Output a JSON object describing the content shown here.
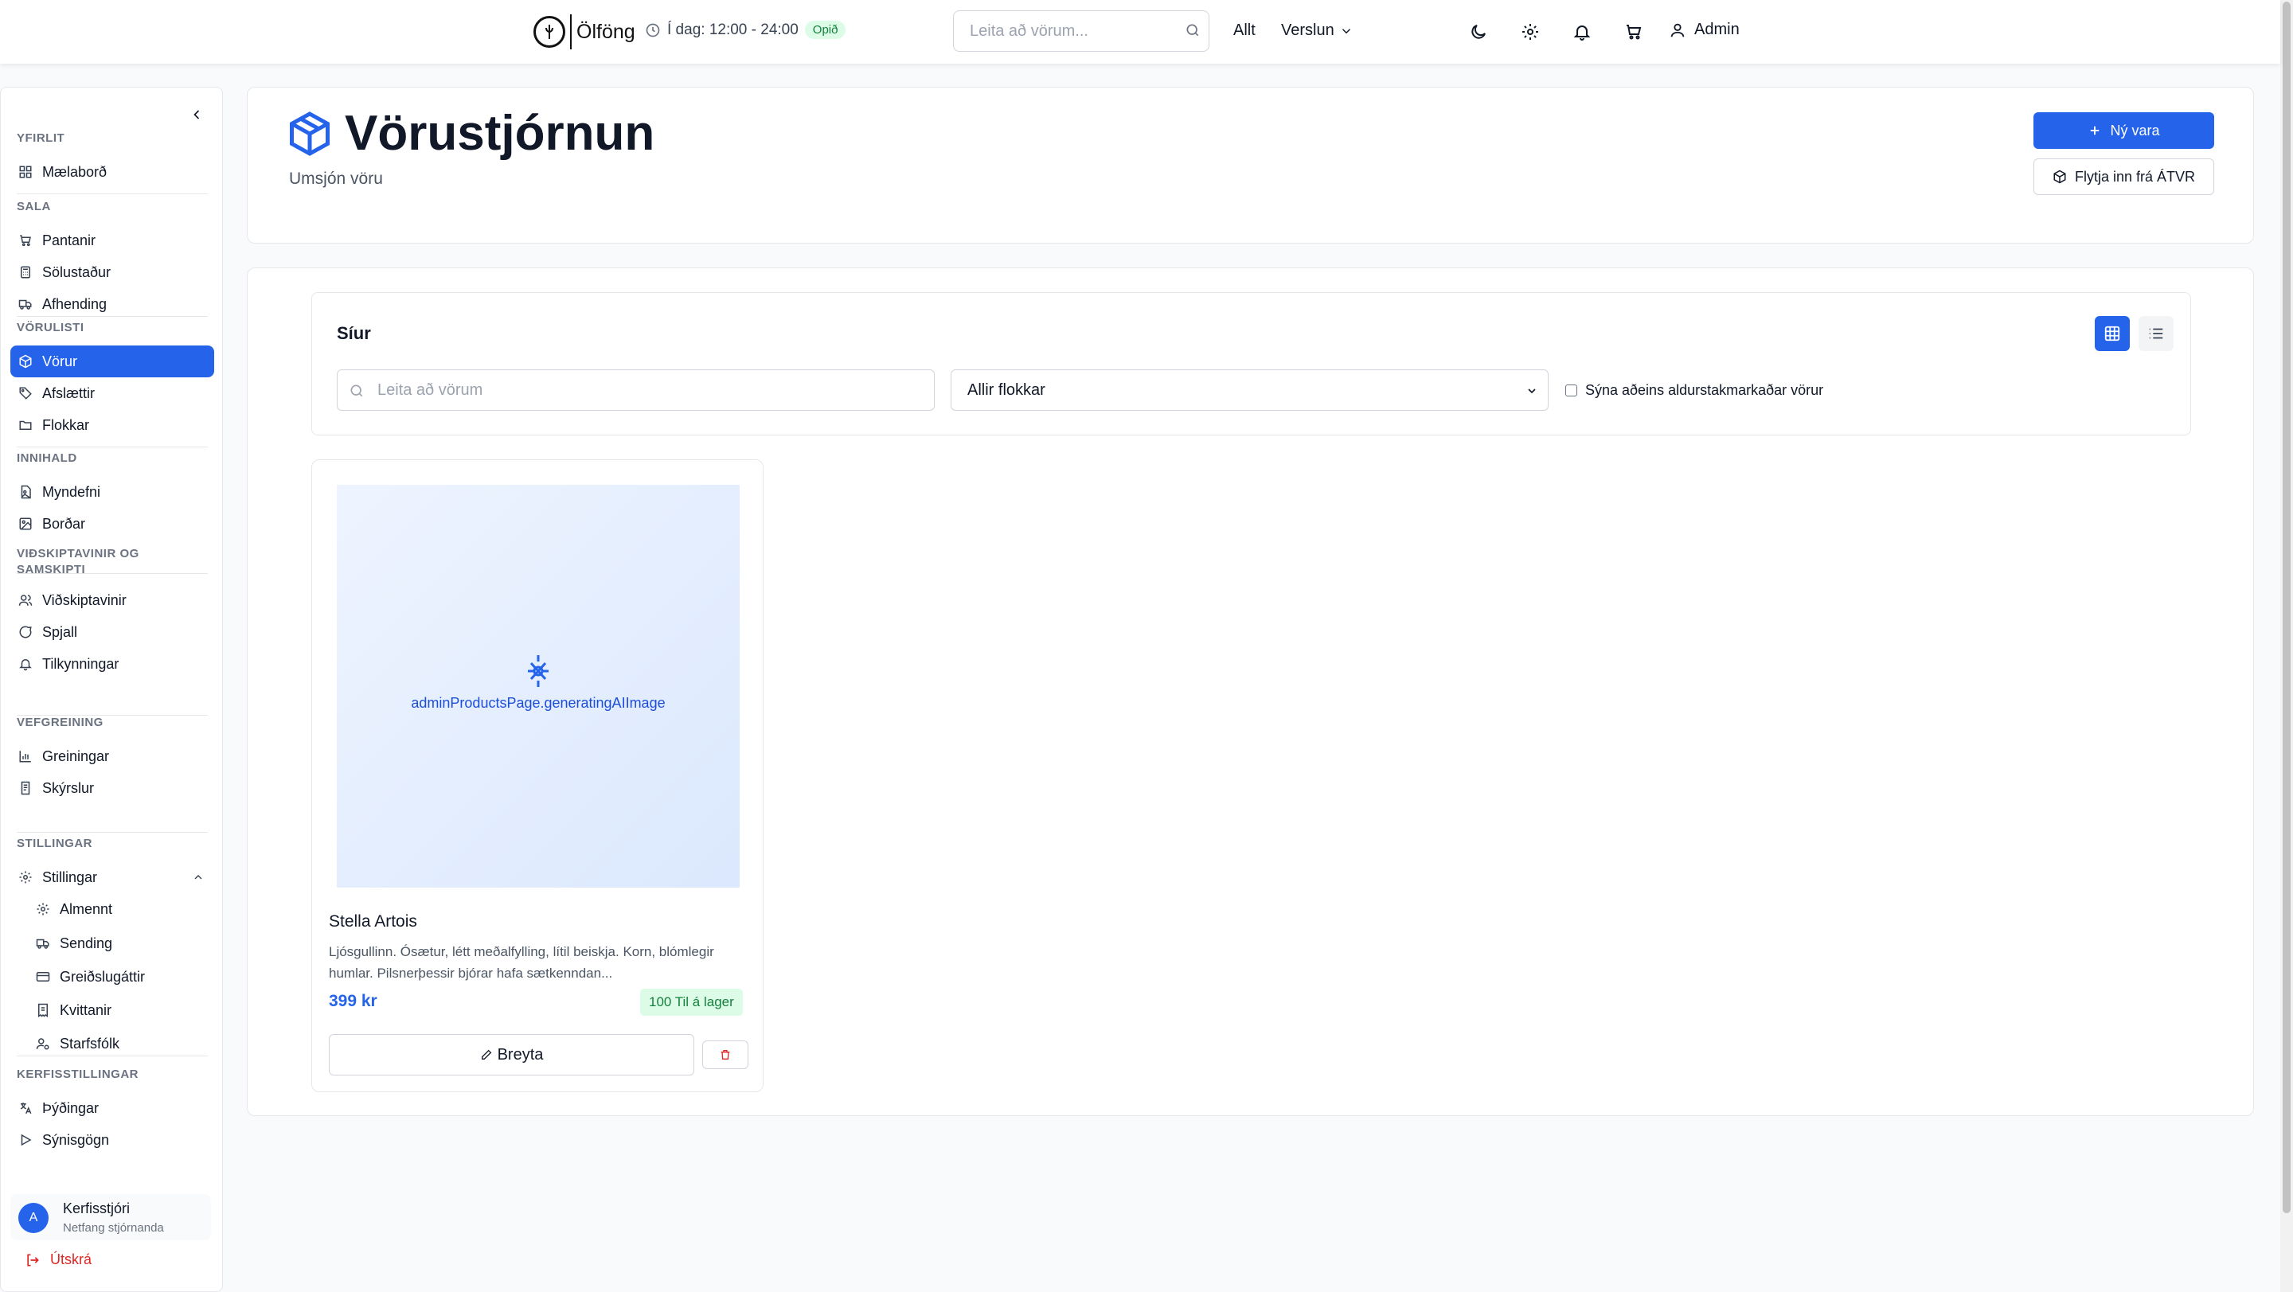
{
  "header": {
    "brand": "Ölföng",
    "hours": "Í dag: 12:00 - 24:00",
    "open_badge": "Opið",
    "search_placeholder": "Leita að vörum...",
    "nav_all": "Allt",
    "nav_shop": "Verslun",
    "user": "Admin"
  },
  "sidebar": {
    "sections": [
      {
        "title": "YFIRLIT",
        "items": [
          {
            "label": "Mælaborð",
            "icon": "grid-icon"
          }
        ]
      },
      {
        "title": "SALA",
        "items": [
          {
            "label": "Pantanir",
            "icon": "cart-icon"
          },
          {
            "label": "Sölustaður",
            "icon": "calculator-icon"
          },
          {
            "label": "Afhending",
            "icon": "truck-icon"
          }
        ]
      },
      {
        "title": "VÖRULISTI",
        "items": [
          {
            "label": "Vörur",
            "icon": "package-icon",
            "active": true
          },
          {
            "label": "Afslættir",
            "icon": "tag-icon"
          },
          {
            "label": "Flokkar",
            "icon": "folder-icon"
          }
        ]
      },
      {
        "title": "INNIHALD",
        "items": [
          {
            "label": "Myndefni",
            "icon": "file-image-icon"
          },
          {
            "label": "Borðar",
            "icon": "image-icon"
          }
        ]
      },
      {
        "title": "VIÐSKIPTAVINIR OG SAMSKIPTI",
        "items": [
          {
            "label": "Viðskiptavinir",
            "icon": "users-icon"
          },
          {
            "label": "Spjall",
            "icon": "chat-icon"
          },
          {
            "label": "Tilkynningar",
            "icon": "bell-icon"
          }
        ]
      },
      {
        "title": "VEFGREINING",
        "items": [
          {
            "label": "Greiningar",
            "icon": "bar-chart-icon"
          },
          {
            "label": "Skýrslur",
            "icon": "report-icon"
          }
        ]
      },
      {
        "title": "STILLINGAR",
        "items": [
          {
            "label": "Stillingar",
            "icon": "gear-icon",
            "expanded": true
          },
          {
            "label": "Almennt",
            "icon": "gear-icon",
            "sub": true
          },
          {
            "label": "Sending",
            "icon": "truck-icon",
            "sub": true
          },
          {
            "label": "Greiðslugáttir",
            "icon": "credit-card-icon",
            "sub": true
          },
          {
            "label": "Kvittanir",
            "icon": "receipt-icon",
            "sub": true
          },
          {
            "label": "Starfsfólk",
            "icon": "user-cog-icon",
            "sub": true
          }
        ]
      },
      {
        "title": "KERFISSTILLINGAR",
        "items": [
          {
            "label": "Þýðingar",
            "icon": "languages-icon"
          },
          {
            "label": "Sýnisgögn",
            "icon": "play-icon"
          }
        ]
      }
    ],
    "user": {
      "initial": "A",
      "name": "Kerfisstjóri",
      "email": "Netfang stjórnanda"
    },
    "logout": "Útskrá"
  },
  "page": {
    "title": "Vörustjórnun",
    "subtitle": "Umsjón vöru",
    "new_button": "Ný vara",
    "import_button": "Flytja inn frá ÁTVR"
  },
  "filters": {
    "title": "Síur",
    "search_placeholder": "Leita að vörum",
    "category": "Allir flokkar",
    "age_only": "Sýna aðeins aldurstakmarkaðar vörur"
  },
  "products": [
    {
      "image_text": "adminProductsPage.generatingAIImage",
      "name": "Stella Artois",
      "description": "Ljósgullinn. Ósætur, létt meðalfylling, lítil beiskja. Korn, blómlegir humlar. Pilsnerþessir bjórar hafa sætkenndan...",
      "price": "399 kr",
      "stock": "100 Til á lager",
      "edit_label": "Breyta"
    }
  ],
  "colors": {
    "accent": "#2563eb",
    "success_bg": "#dcfce7",
    "success_text": "#15803d",
    "danger": "#dc2626"
  }
}
